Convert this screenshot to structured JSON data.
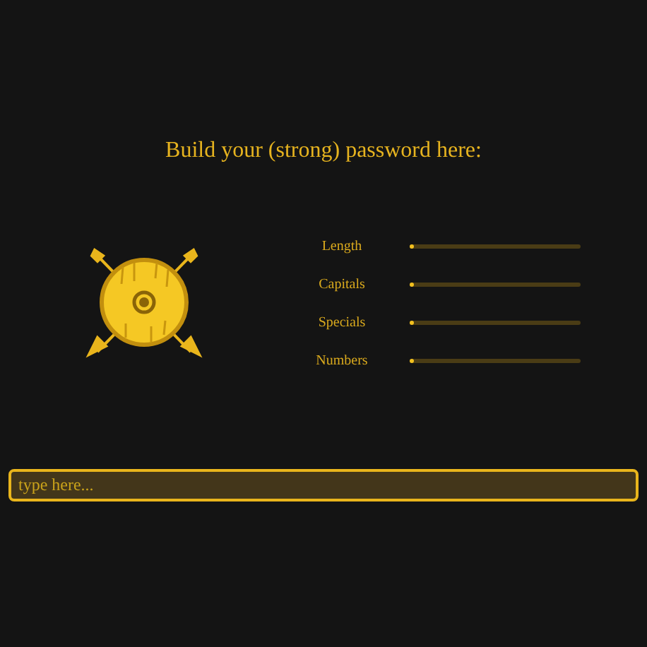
{
  "heading": "Build your (strong) password here:",
  "meters": [
    {
      "label": "Length",
      "level": 0.02
    },
    {
      "label": "Capitals",
      "level": 0.02
    },
    {
      "label": "Specials",
      "level": 0.02
    },
    {
      "label": "Numbers",
      "level": 0.02
    }
  ],
  "input": {
    "placeholder": "type here..."
  }
}
